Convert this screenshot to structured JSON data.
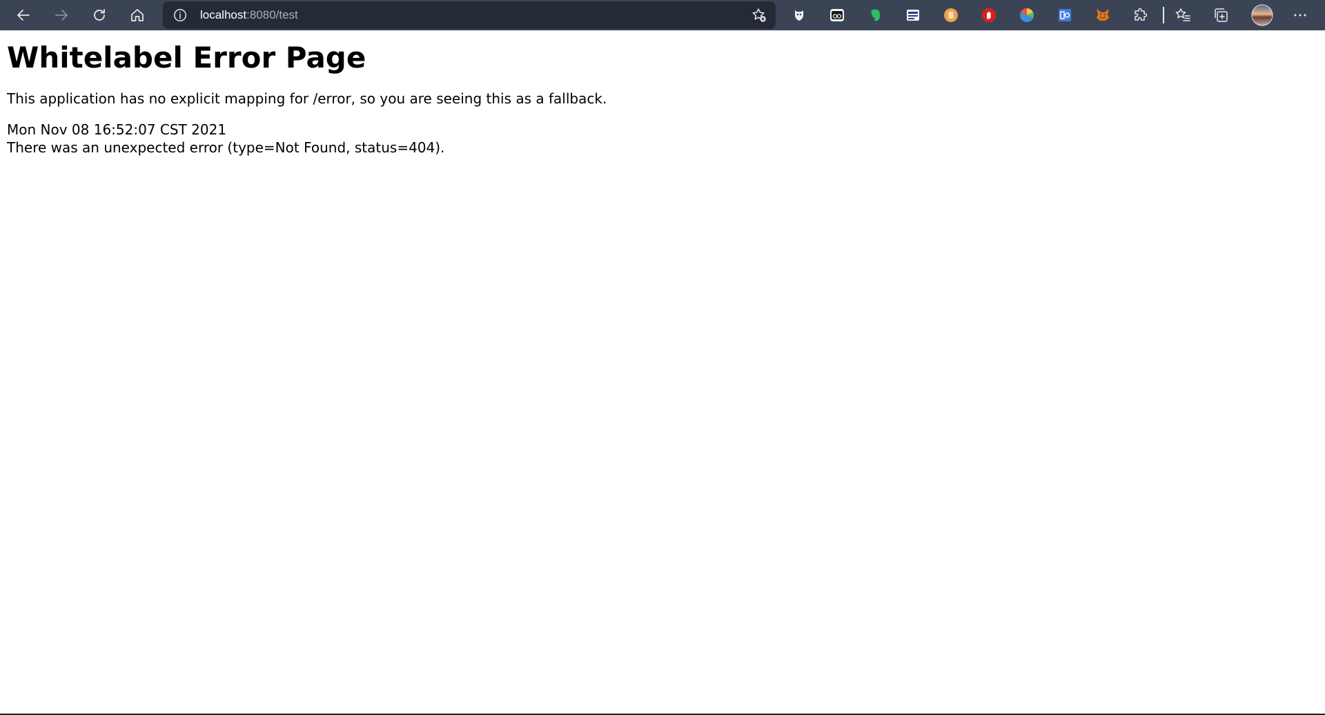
{
  "browser": {
    "address": {
      "host": "localhost",
      "rest": ":8080/test"
    },
    "icons": {
      "back": "arrow-left-icon",
      "forward": "arrow-right-icon",
      "refresh": "refresh-icon",
      "home": "home-icon",
      "site_info": "info-circle-icon",
      "add_favorite": "star-plus-icon",
      "extensions": "puzzle-icon",
      "favorites": "star-list-icon",
      "collections": "collections-icon",
      "profile": "avatar",
      "menu": "more-dots-icon"
    },
    "colors": {
      "toolbar_bg": "#3b4454",
      "address_bg": "#252b36"
    }
  },
  "page": {
    "title": "Whitelabel Error Page",
    "description": "This application has no explicit mapping for /error, so you are seeing this as a fallback.",
    "timestamp": "Mon Nov 08 16:52:07 CST 2021",
    "error_message": "There was an unexpected error (type=Not Found, status=404)."
  }
}
